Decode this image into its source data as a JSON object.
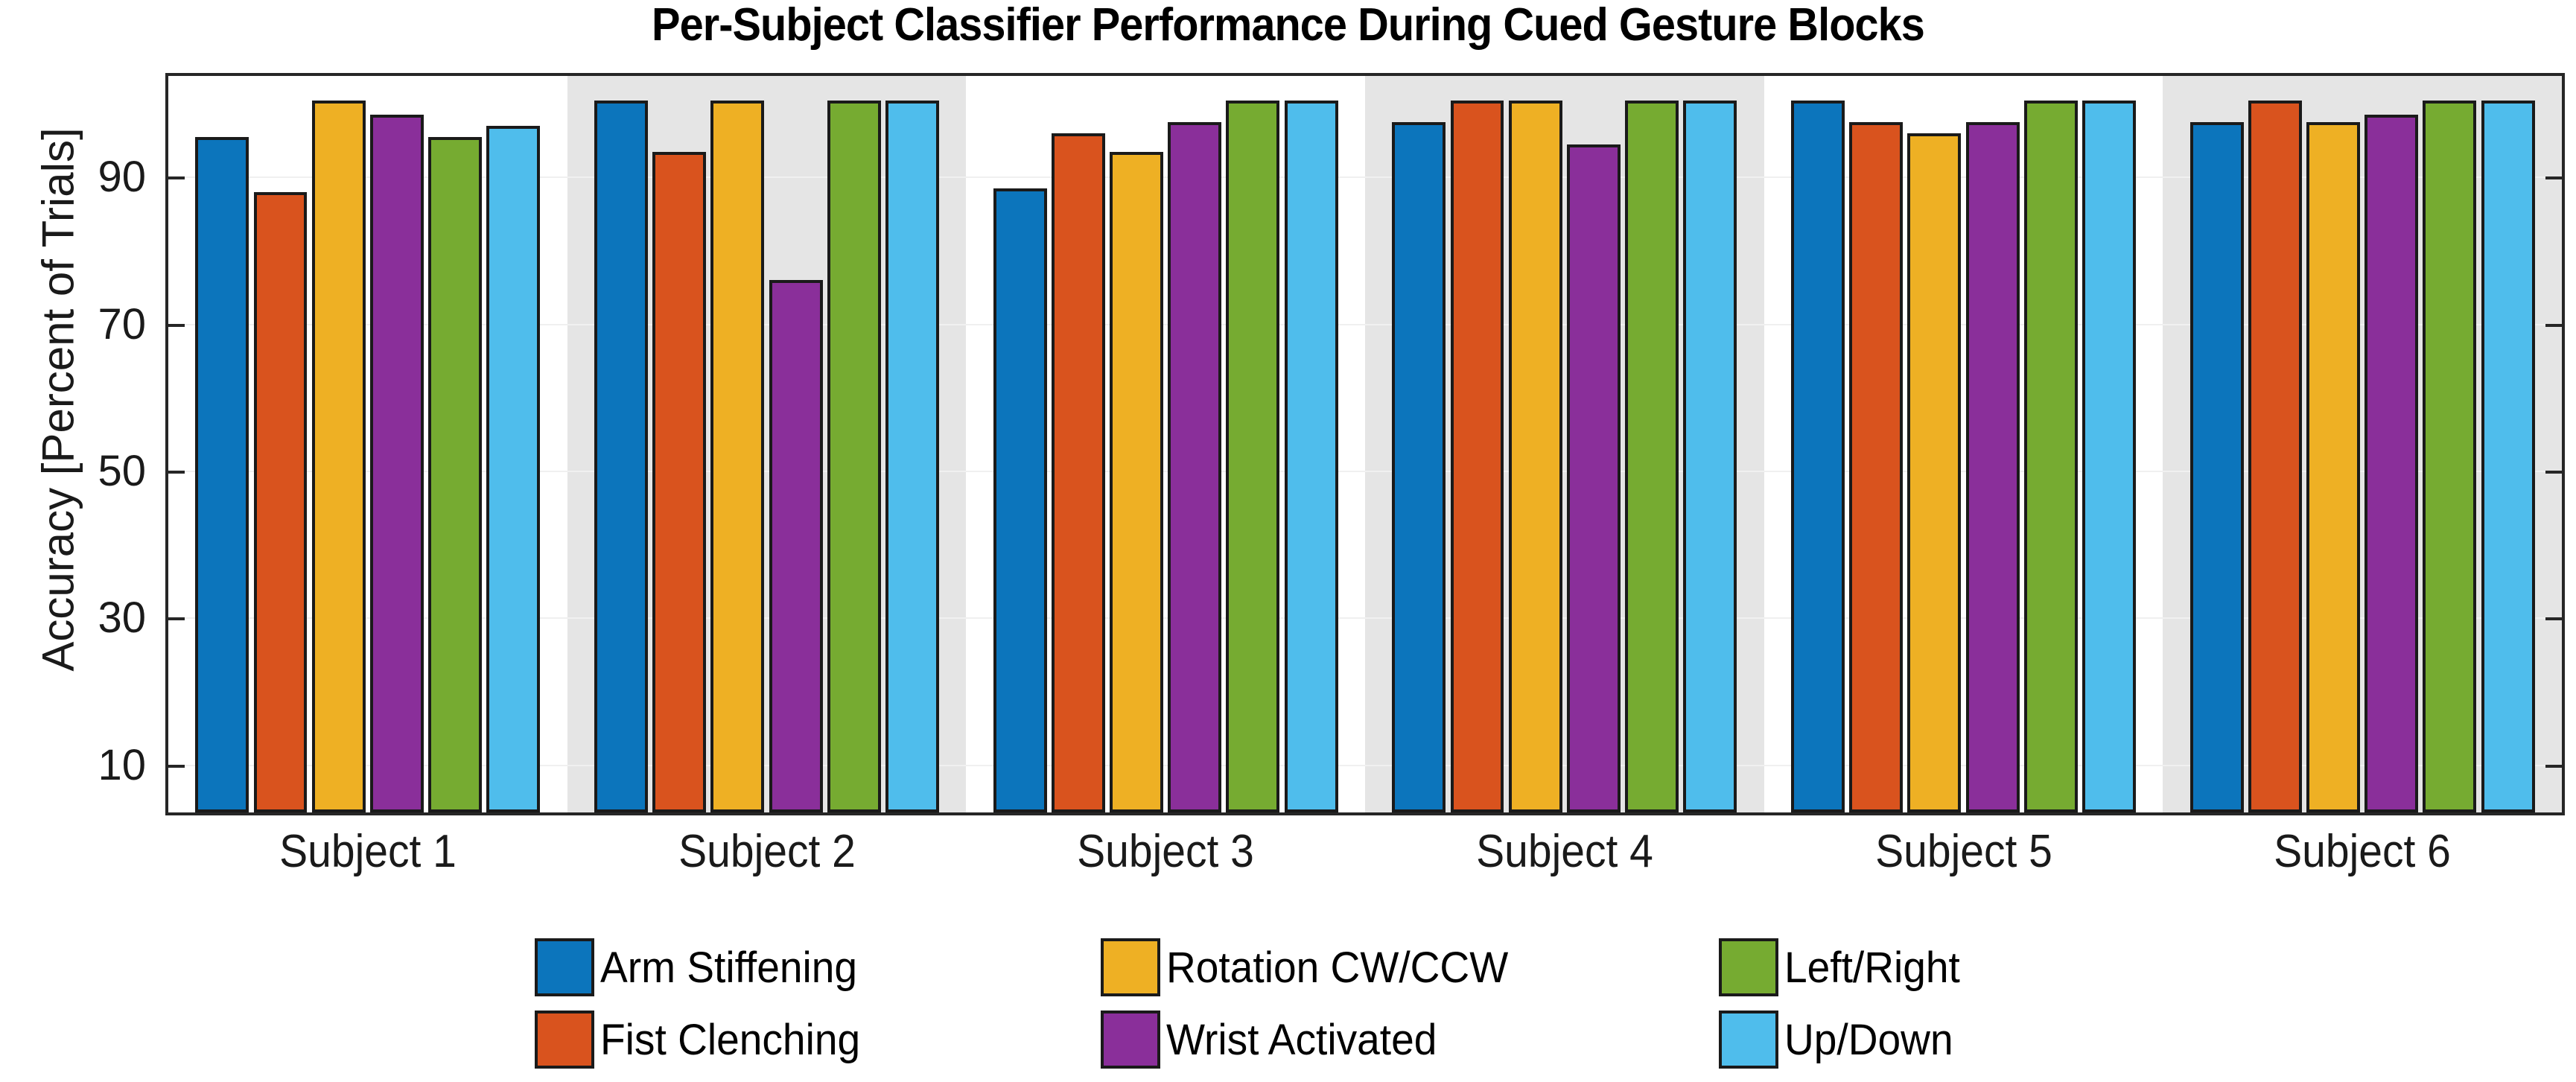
{
  "chart_data": {
    "type": "bar",
    "title": "Per-Subject Classifier Performance During Cued Gesture Blocks",
    "xlabel": "",
    "ylabel": "Accuracy [Percent of Trials]",
    "categories": [
      "Subject 1",
      "Subject 2",
      "Subject 3",
      "Subject 4",
      "Subject 5",
      "Subject 6"
    ],
    "series": [
      {
        "name": "Arm Stiffening",
        "color": "#0c75bc",
        "values": [
          95.0,
          100.0,
          88.0,
          97.0,
          100.0,
          97.0
        ]
      },
      {
        "name": "Fist Clenching",
        "color": "#d9531e",
        "values": [
          87.5,
          93.0,
          95.5,
          100.0,
          97.0,
          100.0
        ]
      },
      {
        "name": "Rotation CW/CCW",
        "color": "#eeb024",
        "values": [
          100.0,
          100.0,
          93.0,
          100.0,
          95.5,
          97.0
        ]
      },
      {
        "name": "Wrist Activated",
        "color": "#8a2f9a",
        "values": [
          98.0,
          75.5,
          97.0,
          94.0,
          97.0,
          98.0
        ]
      },
      {
        "name": "Left/Right",
        "color": "#76ab31",
        "values": [
          95.0,
          100.0,
          100.0,
          100.0,
          100.0,
          100.0
        ]
      },
      {
        "name": "Up/Down",
        "color": "#4fbdec",
        "values": [
          96.5,
          100.0,
          100.0,
          100.0,
          100.0,
          100.0
        ]
      }
    ],
    "yticks": [
      90,
      70,
      50,
      30,
      10
    ],
    "ylim": [
      3.7,
      103.9
    ],
    "grid": true,
    "legend_position": "bottom",
    "legend_entries": [
      "Arm Stiffening",
      "Fist Clenching",
      "Rotation CW/CCW",
      "Wrist Activated",
      "Left/Right",
      "Up/Down"
    ]
  },
  "axis": {
    "tick_color": "#262626",
    "grid_color": "#f0f0f0",
    "band_color": "#e5e5e5",
    "bar_edge_color": "#1a1a1a"
  }
}
